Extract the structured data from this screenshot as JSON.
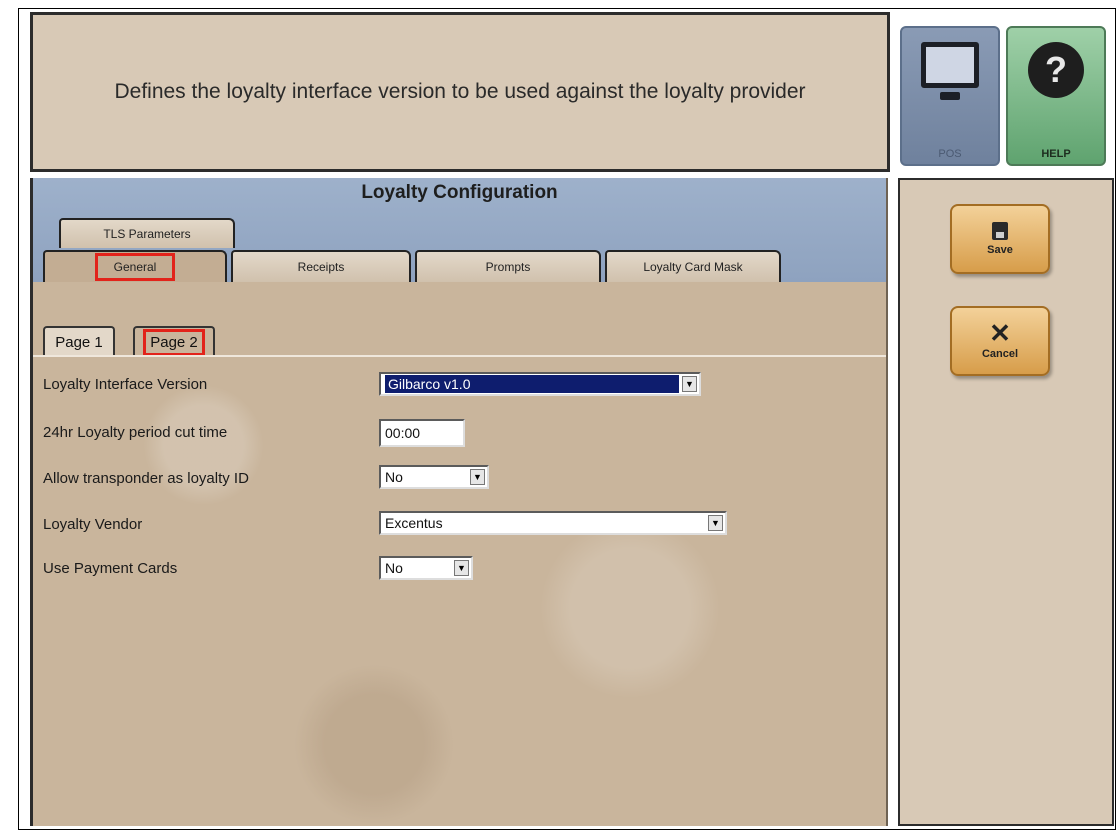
{
  "description": {
    "text": "Defines the loyalty interface version to be used against the loyalty provider"
  },
  "top_buttons": {
    "pos": "POS",
    "help": "HELP"
  },
  "main": {
    "title": "Loyalty Configuration",
    "tabs": [
      {
        "label": "TLS Parameters"
      },
      {
        "label": "General",
        "active": true,
        "highlighted": true
      },
      {
        "label": "Receipts"
      },
      {
        "label": "Prompts"
      },
      {
        "label": "Loyalty Card Mask"
      }
    ],
    "subtabs": [
      {
        "label": "Page 1"
      },
      {
        "label": "Page 2",
        "active": true,
        "highlighted": true
      }
    ],
    "fields": [
      {
        "label": "Loyalty Interface Version",
        "value": "Gilbarco v1.0",
        "type": "select",
        "selected": true
      },
      {
        "label": "24hr Loyalty period cut time",
        "value": "00:00",
        "type": "text"
      },
      {
        "label": "Allow transponder as loyalty ID",
        "value": "No",
        "type": "select"
      },
      {
        "label": "Loyalty Vendor",
        "value": "Excentus",
        "type": "select"
      },
      {
        "label": "Use Payment Cards",
        "value": "No",
        "type": "select"
      }
    ]
  },
  "side": {
    "save": "Save",
    "cancel": "Cancel"
  },
  "colors": {
    "highlight": "#e2231a",
    "selection": "#0e1d6e",
    "action_button": "#e8b86a"
  },
  "icons": {
    "pos": "monitor-icon",
    "help": "question-icon",
    "save": "floppy-disk-icon",
    "cancel": "x-icon"
  }
}
